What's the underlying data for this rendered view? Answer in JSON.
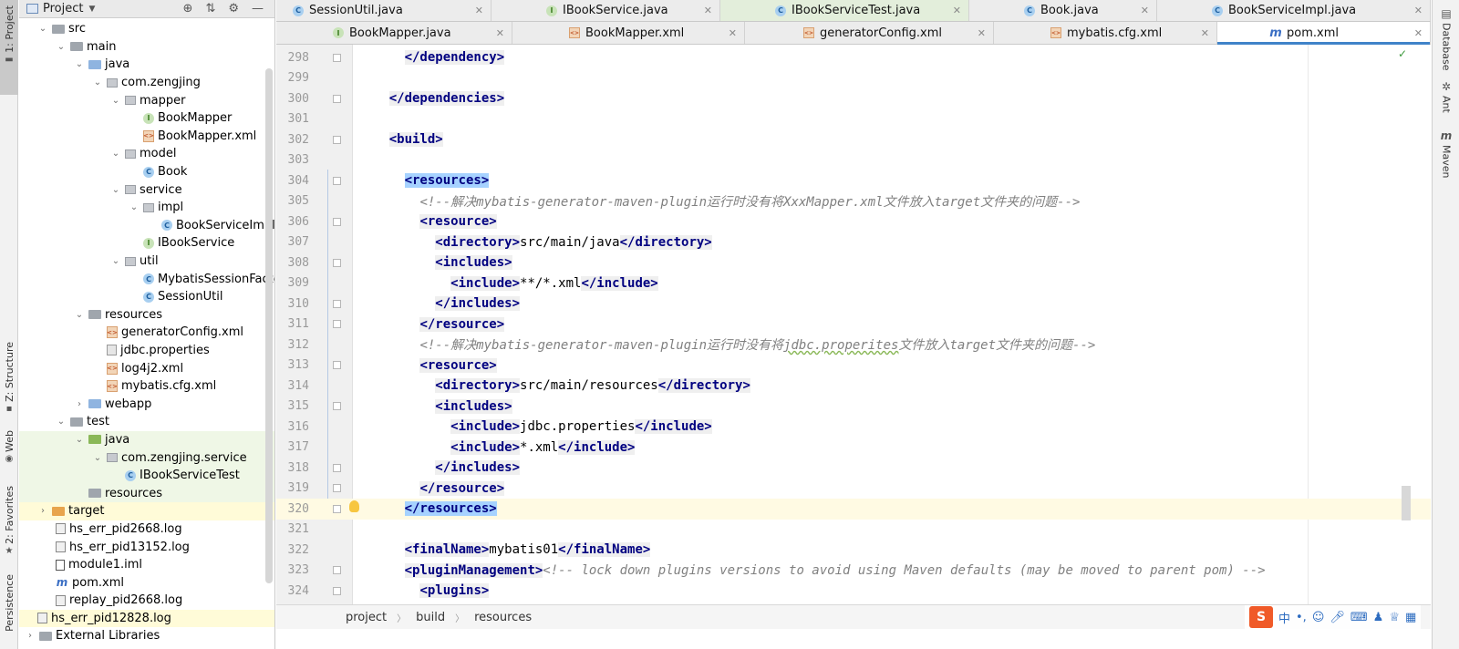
{
  "left_strip": {
    "tabs": [
      {
        "label": "1: Project"
      },
      {
        "label": "Z: Structure"
      },
      {
        "label": "Web"
      },
      {
        "label": "2: Favorites"
      },
      {
        "label": "Persistence"
      }
    ]
  },
  "right_strip": {
    "tabs": [
      {
        "label": "Database"
      },
      {
        "label": "Ant"
      },
      {
        "label": "Maven"
      }
    ]
  },
  "project_panel": {
    "title": "Project",
    "tree": [
      {
        "label": "src"
      },
      {
        "label": "main"
      },
      {
        "label": "java"
      },
      {
        "label": "com.zengjing"
      },
      {
        "label": "mapper"
      },
      {
        "label": "BookMapper",
        "icon_glyph": "I"
      },
      {
        "label": "BookMapper.xml",
        "icon_glyph": "<>"
      },
      {
        "label": "model"
      },
      {
        "label": "Book",
        "icon_glyph": "C"
      },
      {
        "label": "service"
      },
      {
        "label": "impl"
      },
      {
        "label": "BookServiceImpl",
        "icon_glyph": "C"
      },
      {
        "label": "IBookService",
        "icon_glyph": "I"
      },
      {
        "label": "util"
      },
      {
        "label": "MybatisSessionFactor",
        "icon_glyph": "C"
      },
      {
        "label": "SessionUtil",
        "icon_glyph": "C"
      },
      {
        "label": "resources"
      },
      {
        "label": "generatorConfig.xml",
        "icon_glyph": "<>"
      },
      {
        "label": "jdbc.properties"
      },
      {
        "label": "log4j2.xml",
        "icon_glyph": "<>"
      },
      {
        "label": "mybatis.cfg.xml",
        "icon_glyph": "<>"
      },
      {
        "label": "webapp"
      },
      {
        "label": "test"
      },
      {
        "label": "java"
      },
      {
        "label": "com.zengjing.service"
      },
      {
        "label": "IBookServiceTest",
        "icon_glyph": "C"
      },
      {
        "label": "resources"
      },
      {
        "label": "target"
      },
      {
        "label": "hs_err_pid2668.log"
      },
      {
        "label": "hs_err_pid13152.log"
      },
      {
        "label": "module1.iml"
      },
      {
        "label": "pom.xml",
        "icon_glyph": "m"
      },
      {
        "label": "replay_pid2668.log"
      },
      {
        "label": "hs_err_pid12828.log"
      },
      {
        "label": "External Libraries"
      }
    ]
  },
  "tabs_row_1": [
    {
      "label": "SessionUtil.java",
      "icon_glyph": "C"
    },
    {
      "label": "IBookService.java",
      "icon_glyph": "I"
    },
    {
      "label": "IBookServiceTest.java",
      "icon_glyph": "C"
    },
    {
      "label": "Book.java",
      "icon_glyph": "C"
    },
    {
      "label": "BookServiceImpl.java",
      "icon_glyph": "C"
    }
  ],
  "tabs_row_2": [
    {
      "label": "BookMapper.java",
      "icon_glyph": "I"
    },
    {
      "label": "BookMapper.xml",
      "icon_glyph": "<>"
    },
    {
      "label": "generatorConfig.xml",
      "icon_glyph": "<>"
    },
    {
      "label": "mybatis.cfg.xml",
      "icon_glyph": "<>"
    },
    {
      "label": "pom.xml",
      "icon_glyph": "m"
    }
  ],
  "editor": {
    "lines": [
      {
        "num": "298",
        "tokens": [
          [
            "      ",
            ""
          ],
          [
            "</dependency>",
            "t tagbox"
          ]
        ]
      },
      {
        "num": "299",
        "tokens": []
      },
      {
        "num": "300",
        "tokens": [
          [
            "    ",
            ""
          ],
          [
            "</dependencies>",
            "t tagbox"
          ]
        ]
      },
      {
        "num": "301",
        "tokens": []
      },
      {
        "num": "302",
        "tokens": [
          [
            "    ",
            ""
          ],
          [
            "<build>",
            "t tagbox"
          ]
        ]
      },
      {
        "num": "303",
        "tokens": []
      },
      {
        "num": "304",
        "tokens": [
          [
            "      ",
            ""
          ],
          [
            "<resources>",
            "t sel"
          ]
        ]
      },
      {
        "num": "305",
        "tokens": [
          [
            "        ",
            ""
          ],
          [
            "<!--解决mybatis-generator-maven-plugin运行时没有将XxxMapper.xml文件放入target文件夹的问题-->",
            "cm"
          ]
        ]
      },
      {
        "num": "306",
        "tokens": [
          [
            "        ",
            ""
          ],
          [
            "<resource>",
            "t tagbox"
          ]
        ]
      },
      {
        "num": "307",
        "tokens": [
          [
            "          ",
            ""
          ],
          [
            "<directory>",
            "t tagbox"
          ],
          [
            "src/main/java",
            ""
          ],
          [
            "</directory>",
            "t tagbox"
          ]
        ]
      },
      {
        "num": "308",
        "tokens": [
          [
            "          ",
            ""
          ],
          [
            "<includes>",
            "t tagbox"
          ]
        ]
      },
      {
        "num": "309",
        "tokens": [
          [
            "            ",
            ""
          ],
          [
            "<include>",
            "t tagbox"
          ],
          [
            "**/*.xml",
            ""
          ],
          [
            "</include>",
            "t tagbox"
          ]
        ]
      },
      {
        "num": "310",
        "tokens": [
          [
            "          ",
            ""
          ],
          [
            "</includes>",
            "t tagbox"
          ]
        ]
      },
      {
        "num": "311",
        "tokens": [
          [
            "        ",
            ""
          ],
          [
            "</resource>",
            "t tagbox"
          ]
        ]
      },
      {
        "num": "312",
        "tokens": [
          [
            "        ",
            ""
          ],
          [
            "<!--解决mybatis-generator-maven-plugin运行时没有将",
            "cm"
          ],
          [
            "jdbc.properites",
            "cm squig"
          ],
          [
            "文件放入target文件夹的问题-->",
            "cm"
          ]
        ]
      },
      {
        "num": "313",
        "tokens": [
          [
            "        ",
            ""
          ],
          [
            "<resource>",
            "t tagbox"
          ]
        ]
      },
      {
        "num": "314",
        "tokens": [
          [
            "          ",
            ""
          ],
          [
            "<directory>",
            "t tagbox"
          ],
          [
            "src/main/resources",
            ""
          ],
          [
            "</directory>",
            "t tagbox"
          ]
        ]
      },
      {
        "num": "315",
        "tokens": [
          [
            "          ",
            ""
          ],
          [
            "<includes>",
            "t tagbox"
          ]
        ]
      },
      {
        "num": "316",
        "tokens": [
          [
            "            ",
            ""
          ],
          [
            "<include>",
            "t tagbox"
          ],
          [
            "jdbc.properties",
            ""
          ],
          [
            "</include>",
            "t tagbox"
          ]
        ]
      },
      {
        "num": "317",
        "tokens": [
          [
            "            ",
            ""
          ],
          [
            "<include>",
            "t tagbox"
          ],
          [
            "*.xml",
            ""
          ],
          [
            "</include>",
            "t tagbox"
          ]
        ]
      },
      {
        "num": "318",
        "tokens": [
          [
            "          ",
            ""
          ],
          [
            "</includes>",
            "t tagbox"
          ]
        ]
      },
      {
        "num": "319",
        "tokens": [
          [
            "        ",
            ""
          ],
          [
            "</resource>",
            "t tagbox"
          ]
        ]
      },
      {
        "num": "320",
        "tokens": [
          [
            "      ",
            ""
          ],
          [
            "</resources>",
            "t sel"
          ]
        ]
      },
      {
        "num": "321",
        "tokens": []
      },
      {
        "num": "322",
        "tokens": [
          [
            "      ",
            ""
          ],
          [
            "<finalName>",
            "t tagbox"
          ],
          [
            "mybatis01",
            ""
          ],
          [
            "</finalName>",
            "t tagbox"
          ]
        ]
      },
      {
        "num": "323",
        "tokens": [
          [
            "      ",
            ""
          ],
          [
            "<pluginManagement>",
            "t tagbox"
          ],
          [
            "<!-- lock down plugins versions to avoid using Maven defaults (may be moved to parent pom) -->",
            "cm"
          ]
        ]
      },
      {
        "num": "324",
        "tokens": [
          [
            "        ",
            ""
          ],
          [
            "<plugins>",
            "t tagbox"
          ]
        ]
      }
    ]
  },
  "breadcrumb": [
    "project",
    "build",
    "resources"
  ],
  "ime": {
    "logo": "S",
    "lang": "中"
  },
  "colors": {
    "tag": "#000080",
    "comment": "#808080",
    "selection": "#a6d2ff",
    "current_line": "#fffae3",
    "active_tab_underline": "#4083c9"
  }
}
